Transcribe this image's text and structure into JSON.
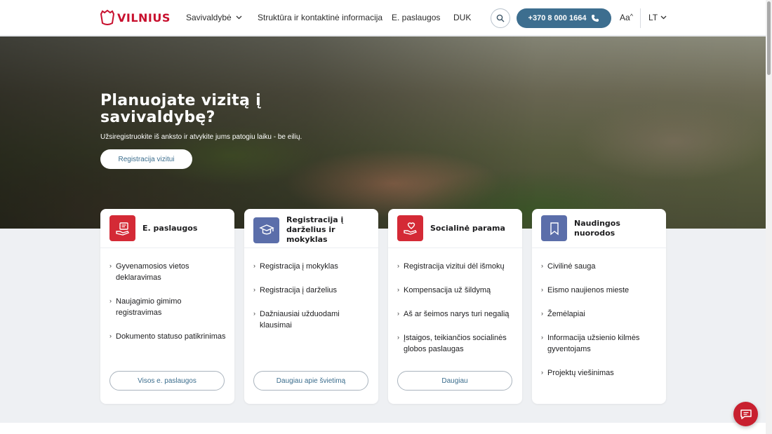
{
  "header": {
    "logo_text": "VILNIUS",
    "nav": [
      {
        "label": "Savivaldybė",
        "has_dropdown": true
      },
      {
        "label": "Struktūra ir kontaktinė informacija"
      },
      {
        "label": "E. paslaugos"
      },
      {
        "label": "DUK"
      }
    ],
    "phone": "+370 8 000 1664",
    "font_size_label": "Aa",
    "language": "LT"
  },
  "hero": {
    "title": "Planuojate vizitą į savivaldybę?",
    "subtitle": "Užsiregistruokite iš anksto ir atvykite jums patogiu laiku - be eilių.",
    "button": "Registracija vizitui"
  },
  "cards": [
    {
      "title": "E. paslaugos",
      "icon": "hand-document-icon",
      "links": [
        "Gyvenamosios vietos deklaravimas",
        "Naujagimio gimimo registravimas",
        "Dokumento statuso patikrinimas"
      ],
      "button": "Visos e. paslaugos"
    },
    {
      "title": "Registracija į darželius ir mokyklas",
      "icon": "graduation-cap-icon",
      "links": [
        "Registracija į mokyklas",
        "Registracija į darželius",
        "Dažniausiai užduodami klausimai"
      ],
      "button": "Daugiau apie švietimą"
    },
    {
      "title": "Socialinė parama",
      "icon": "hand-heart-icon",
      "links": [
        "Registracija vizitui dėl išmokų",
        "Kompensacija už šildymą",
        "Aš ar šeimos narys turi negalią",
        "Įstaigos, teikiančios socialinės globos paslaugas"
      ],
      "button": "Daugiau"
    },
    {
      "title": "Naudingos nuorodos",
      "icon": "bookmark-icon",
      "links": [
        "Civilinė sauga",
        "Eismo naujienos mieste",
        "Žemėlapiai",
        "Informacija užsienio kilmės gyventojams",
        "Projektų viešinimas"
      ]
    }
  ],
  "colors": {
    "brand_red": "#c8102e",
    "accent_blue": "#3d6e8f",
    "card_icon_red": "#d42a36",
    "card_icon_blue": "#5b6eaa"
  }
}
